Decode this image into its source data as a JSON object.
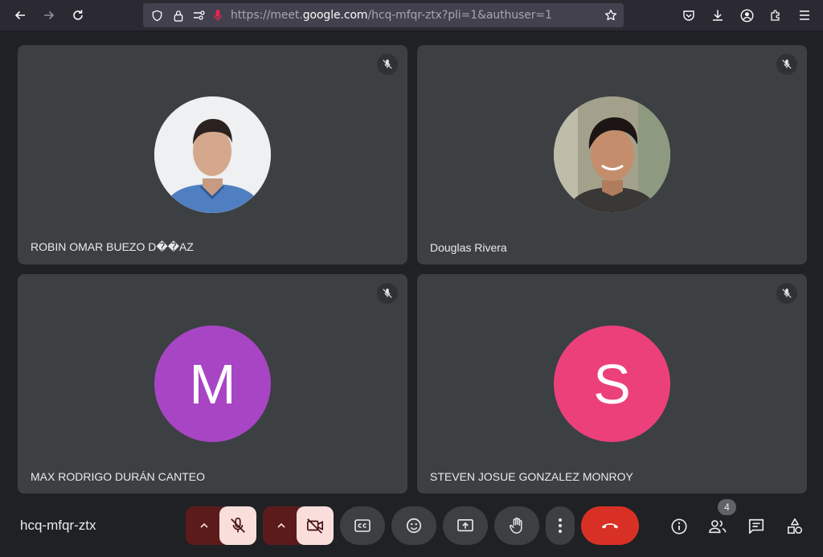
{
  "browser": {
    "url_prefix": "https://meet.",
    "url_host": "google.com",
    "url_suffix": "/hcq-mfqr-ztx?pli=1&authuser=1"
  },
  "tiles": [
    {
      "name": "ROBIN OMAR BUEZO D��AZ",
      "avatar_type": "photo",
      "avatar_letter": "",
      "muted": true
    },
    {
      "name": "Douglas Rivera",
      "avatar_type": "photo",
      "avatar_letter": "",
      "muted": true
    },
    {
      "name": "MAX RODRIGO DURÁN CANTEO",
      "avatar_type": "letter",
      "avatar_letter": "M",
      "avatar_color": "#a845c4",
      "muted": true
    },
    {
      "name": "STEVEN JOSUE GONZALEZ MONROY",
      "avatar_type": "letter",
      "avatar_letter": "S",
      "avatar_color": "#ec407a",
      "muted": true
    }
  ],
  "meeting": {
    "code": "hcq-mfqr-ztx",
    "participants_count": "4"
  },
  "colors": {
    "background": "#202124",
    "tile": "#3c4043",
    "end_call": "#d93025",
    "mic_off_bg": "#f9dedc",
    "mic_off_arrow_bg": "#5c1b1b"
  },
  "icons": {
    "mic": "mic-off-icon",
    "cam": "videocam-off-icon",
    "captions": "closed-caption-icon",
    "emoji": "emoji-icon",
    "present": "present-screen-icon",
    "hand": "raise-hand-icon",
    "more": "more-vert-icon",
    "end": "call-end-icon",
    "info": "info-icon",
    "people": "people-icon",
    "chat": "chat-icon",
    "activities": "activities-icon"
  }
}
